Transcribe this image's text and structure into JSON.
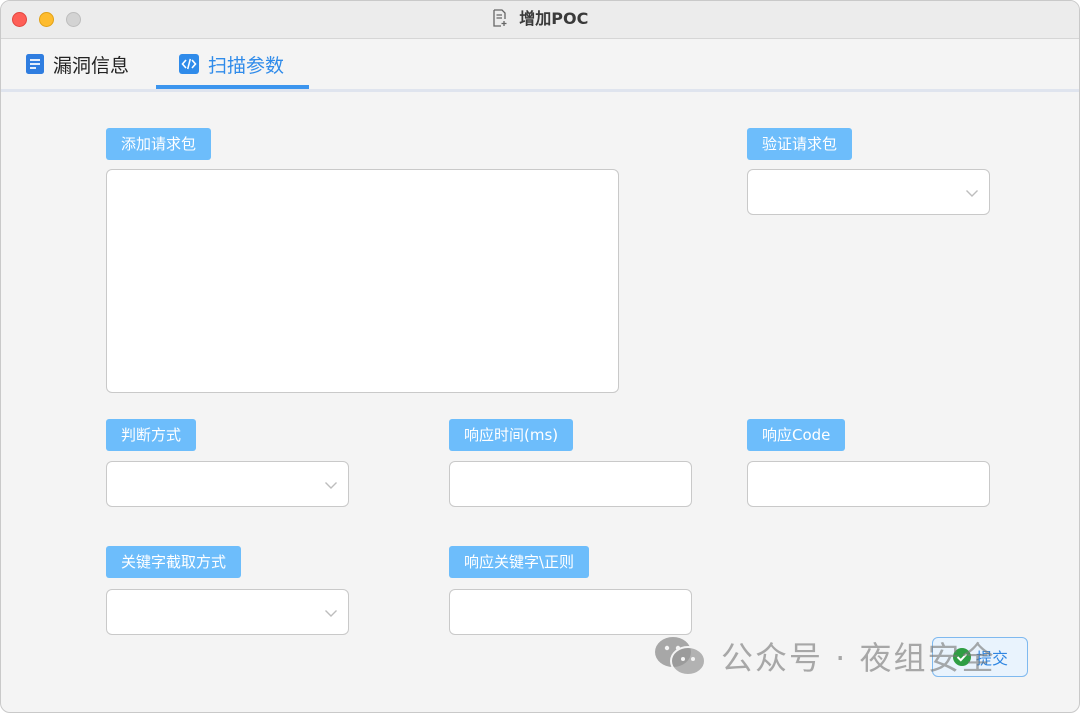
{
  "window": {
    "title": "增加POC"
  },
  "tabs": [
    {
      "label": "漏洞信息",
      "icon": "document-icon",
      "active": false
    },
    {
      "label": "扫描参数",
      "icon": "code-icon",
      "active": true
    }
  ],
  "form": {
    "add_request": {
      "label": "添加请求包",
      "value": ""
    },
    "verify_request": {
      "label": "验证请求包",
      "selected": ""
    },
    "judge_method": {
      "label": "判断方式",
      "selected": ""
    },
    "response_time": {
      "label": "响应时间(ms)",
      "value": ""
    },
    "response_code": {
      "label": "响应Code",
      "value": ""
    },
    "keyword_method": {
      "label": "关键字截取方式",
      "selected": ""
    },
    "response_keyword": {
      "label": "响应关键字\\正则",
      "value": ""
    }
  },
  "submit": {
    "label": "提交",
    "icon": "submit-icon"
  },
  "watermark": {
    "text": "公众号 · 夜组安全",
    "icon": "wechat-icon"
  },
  "colors": {
    "accent": "#3c95ee",
    "label_bg": "#6dbdfb",
    "window_bg": "#f4f4f4"
  }
}
